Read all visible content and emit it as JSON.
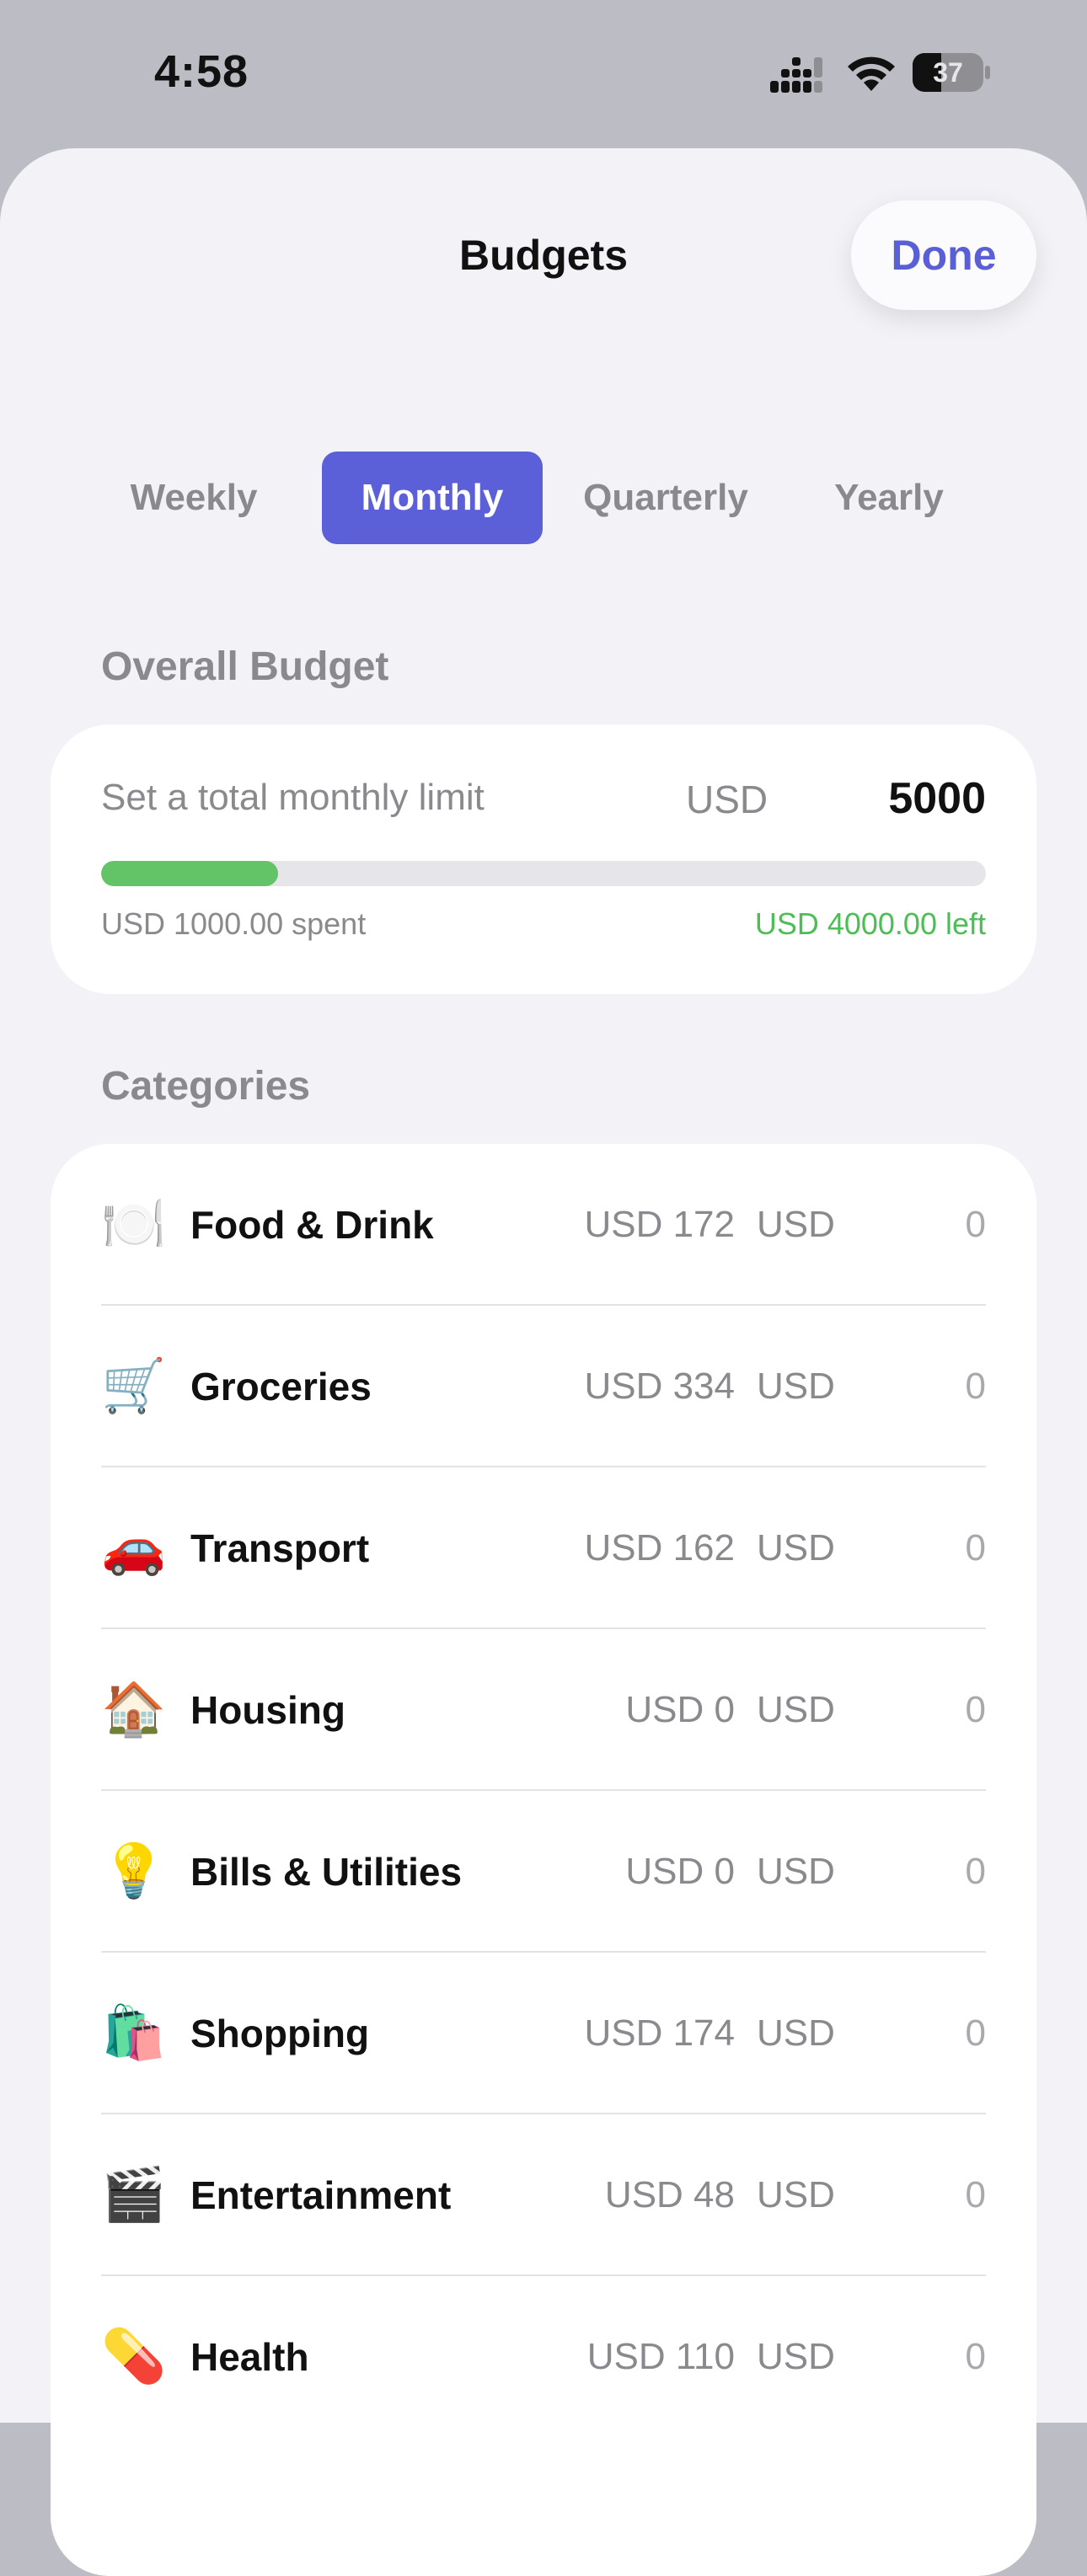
{
  "status_bar": {
    "time": "4:58",
    "battery": "37"
  },
  "sheet": {
    "title": "Budgets",
    "done_label": "Done"
  },
  "period_tabs": [
    {
      "label": "Weekly",
      "active": false
    },
    {
      "label": "Monthly",
      "active": true
    },
    {
      "label": "Quarterly",
      "active": false
    },
    {
      "label": "Yearly",
      "active": false
    }
  ],
  "overall": {
    "section_label": "Overall Budget",
    "limit_label": "Set a total monthly limit",
    "currency": "USD",
    "limit_value": "5000",
    "progress_fraction": 0.2,
    "spent_text": "USD 1000.00 spent",
    "left_text": "USD 4000.00 left"
  },
  "categories": {
    "section_label": "Categories",
    "items": [
      {
        "emoji": "🍽️",
        "icon": "plate-icon",
        "name": "Food & Drink",
        "spent": "USD 172",
        "currency": "USD",
        "budget": "0"
      },
      {
        "emoji": "🛒",
        "icon": "shopping-cart-icon",
        "name": "Groceries",
        "spent": "USD 334",
        "currency": "USD",
        "budget": "0"
      },
      {
        "emoji": "🚗",
        "icon": "car-icon",
        "name": "Transport",
        "spent": "USD 162",
        "currency": "USD",
        "budget": "0"
      },
      {
        "emoji": "🏠",
        "icon": "house-icon",
        "name": "Housing",
        "spent": "USD 0",
        "currency": "USD",
        "budget": "0"
      },
      {
        "emoji": "💡",
        "icon": "light-bulb-icon",
        "name": "Bills & Utilities",
        "spent": "USD 0",
        "currency": "USD",
        "budget": "0"
      },
      {
        "emoji": "🛍️",
        "icon": "shopping-bags-icon",
        "name": "Shopping",
        "spent": "USD 174",
        "currency": "USD",
        "budget": "0"
      },
      {
        "emoji": "🎬",
        "icon": "clapper-board-icon",
        "name": "Entertainment",
        "spent": "USD 48",
        "currency": "USD",
        "budget": "0"
      },
      {
        "emoji": "💊",
        "icon": "pill-icon",
        "name": "Health",
        "spent": "USD 110",
        "currency": "USD",
        "budget": "0"
      }
    ]
  },
  "colors": {
    "accent": "#5b5fd8",
    "progress": "#62c466",
    "left_text": "#4cbe55",
    "background": "#f2f2f7"
  }
}
